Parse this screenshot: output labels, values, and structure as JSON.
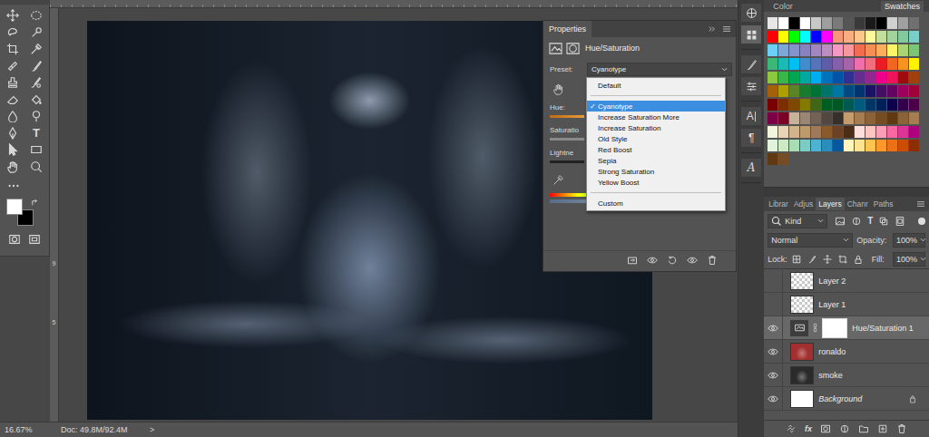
{
  "toolbar": {
    "type_glyph": "T",
    "foreground": "#ffffff",
    "background": "#000000"
  },
  "rulers": {
    "left_labels": [
      "9",
      "5"
    ]
  },
  "properties": {
    "tab": "Properties",
    "adjustment": "Hue/Saturation",
    "preset_label": "Preset:",
    "preset_value": "Cyanotype",
    "check_glyph": "✓",
    "labels": [
      "Hue:",
      "Saturatio",
      "Lightne"
    ],
    "preset_menu": [
      {
        "label": "Default",
        "kind": "item",
        "selected": false,
        "checked": false
      },
      {
        "label": "",
        "kind": "separator",
        "selected": false,
        "checked": false
      },
      {
        "label": "Cyanotype",
        "kind": "item",
        "selected": true,
        "checked": true
      },
      {
        "label": "Increase Saturation More",
        "kind": "item",
        "selected": false,
        "checked": false
      },
      {
        "label": "Increase Saturation",
        "kind": "item",
        "selected": false,
        "checked": false
      },
      {
        "label": "Old Style",
        "kind": "item",
        "selected": false,
        "checked": false
      },
      {
        "label": "Red Boost",
        "kind": "item",
        "selected": false,
        "checked": false
      },
      {
        "label": "Sepia",
        "kind": "item",
        "selected": false,
        "checked": false
      },
      {
        "label": "Strong Saturation",
        "kind": "item",
        "selected": false,
        "checked": false
      },
      {
        "label": "Yellow Boost",
        "kind": "item",
        "selected": false,
        "checked": false
      },
      {
        "label": "",
        "kind": "separator",
        "selected": false,
        "checked": false
      },
      {
        "label": "Custom",
        "kind": "item",
        "selected": false,
        "checked": false
      }
    ]
  },
  "status_bar": {
    "zoom": "16.67%",
    "doc": "Doc: 49.8M/92.4M",
    "arrow": ">"
  },
  "color_panel": {
    "tabs": [
      {
        "label": "Color",
        "selected": false
      },
      {
        "label": "Swatches",
        "selected": true
      }
    ],
    "swatches": [
      "#e6e6e6",
      "#ffffff",
      "#000000",
      "#ffffff",
      "#c8c8c8",
      "#9e9e9e",
      "#7a7a7a",
      "#555555",
      "#3a3a3a",
      "#1a1a1a",
      "#000000",
      "#d0d0d0",
      "#a0a0a0",
      "#707070",
      "#ff0000",
      "#ffff00",
      "#00ff00",
      "#00ffff",
      "#0000ff",
      "#ff00ff",
      "#f7977a",
      "#f9ad81",
      "#fdc68a",
      "#fff79a",
      "#c4df9b",
      "#a2d39c",
      "#82ca9d",
      "#7bcdc8",
      "#6ecff6",
      "#7ea7d8",
      "#8493ca",
      "#8882be",
      "#a187be",
      "#bc8dbf",
      "#f49ac2",
      "#f6989d",
      "#f26c4f",
      "#f68e55",
      "#fbaf5c",
      "#fff467",
      "#acd372",
      "#7cc576",
      "#3bb878",
      "#1abbb4",
      "#00bff3",
      "#438ccb",
      "#5574b9",
      "#605ca8",
      "#855fa8",
      "#a763a8",
      "#f06ea9",
      "#f26d7d",
      "#ed1c24",
      "#f26522",
      "#f7941d",
      "#fff200",
      "#8dc73f",
      "#39b54a",
      "#00a651",
      "#00a99d",
      "#00aeef",
      "#0072bc",
      "#0054a6",
      "#2e3192",
      "#662d91",
      "#92278f",
      "#ec008c",
      "#ed145b",
      "#9e0b0f",
      "#a0410d",
      "#a3620a",
      "#aba000",
      "#598527",
      "#197b30",
      "#007236",
      "#00746b",
      "#0076a3",
      "#004a80",
      "#003471",
      "#1b1464",
      "#440e62",
      "#630460",
      "#9e005d",
      "#9e0039",
      "#790000",
      "#7b2e00",
      "#7d4900",
      "#827b00",
      "#406618",
      "#005e20",
      "#005826",
      "#005952",
      "#005b7f",
      "#003663",
      "#002157",
      "#0d004c",
      "#32004b",
      "#4b0049",
      "#7b0046",
      "#7a0026",
      "#c7b299",
      "#998675",
      "#736357",
      "#534741",
      "#37302a",
      "#c69c6d",
      "#a67c52",
      "#8c6239",
      "#754c24",
      "#603913",
      "#8c6239",
      "#a67c52",
      "#f5f5dc",
      "#e8d5b5",
      "#d2b48c",
      "#bc9a6c",
      "#a0785a",
      "#8b5a2b",
      "#6b4226",
      "#4a2c17",
      "#fde0dd",
      "#fcc5c0",
      "#fa9fb5",
      "#f768a1",
      "#dd3497",
      "#ae017e",
      "#e0f3db",
      "#ccebc5",
      "#a8ddb5",
      "#7bccc4",
      "#4eb3d3",
      "#2b8cbe",
      "#08589e",
      "#fff7bc",
      "#fee391",
      "#fec44f",
      "#fe9929",
      "#ec7014",
      "#cc4c02",
      "#8c2d04",
      "#603913",
      "#754c24"
    ]
  },
  "side_strip": {
    "glyphs": [
      "A",
      "¶",
      "A"
    ]
  },
  "layers_panel": {
    "tabs": [
      {
        "label": "Librar",
        "selected": false
      },
      {
        "label": "Adjus",
        "selected": false
      },
      {
        "label": "Layers",
        "selected": true
      },
      {
        "label": "Chanr",
        "selected": false
      },
      {
        "label": "Paths",
        "selected": false
      }
    ],
    "filter_label": "Kind",
    "filter_glyph": "T",
    "blend_mode": "Normal",
    "opacity_label": "Opacity:",
    "opacity": "100%",
    "lock_label": "Lock:",
    "fill_label": "Fill:",
    "fill": "100%",
    "footer_glyph": "fx",
    "layers": [
      {
        "name": "Layer 2",
        "visible": false,
        "selected": false,
        "kind": "empty",
        "locked": false,
        "color": "#ffffff"
      },
      {
        "name": "Layer 1",
        "visible": false,
        "selected": false,
        "kind": "empty",
        "locked": false,
        "color": "#ffffff"
      },
      {
        "name": "Hue/Saturation 1",
        "visible": true,
        "selected": true,
        "kind": "adjustment",
        "locked": false,
        "color": "#ffffff"
      },
      {
        "name": "ronaldo",
        "visible": true,
        "selected": false,
        "kind": "photo",
        "locked": false,
        "color": "#a33030"
      },
      {
        "name": "smoke",
        "visible": true,
        "selected": false,
        "kind": "photo",
        "locked": false,
        "color": "#2b2b2b"
      },
      {
        "name": "Background",
        "visible": true,
        "selected": false,
        "kind": "background",
        "locked": true,
        "color": "#ffffff"
      }
    ]
  }
}
